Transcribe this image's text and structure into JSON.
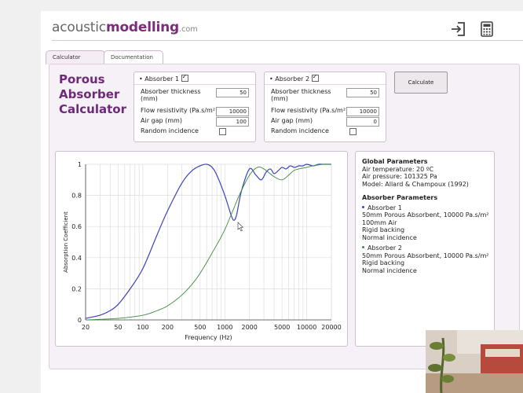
{
  "logo": {
    "part1": "acoustic",
    "part2": "modelling",
    "part3": ".com"
  },
  "tabs": [
    {
      "label": "Calculator"
    },
    {
      "label": "Documentation"
    }
  ],
  "title": {
    "line1": "Porous",
    "line2": "Absorber",
    "line3": "Calculator"
  },
  "absorbers": [
    {
      "header": "Absorber 1",
      "enabled": true,
      "fields": {
        "thickness_label": "Absorber thickness (mm)",
        "thickness_value": "50",
        "resistivity_label": "Flow resistivity (Pa.s/m²)",
        "resistivity_value": "10000",
        "airgap_label": "Air gap (mm)",
        "airgap_value": "100",
        "random_label": "Random incidence"
      }
    },
    {
      "header": "Absorber 2",
      "enabled": true,
      "fields": {
        "thickness_label": "Absorber thickness (mm)",
        "thickness_value": "50",
        "resistivity_label": "Flow resistivity (Pa.s/m²)",
        "resistivity_value": "10000",
        "airgap_label": "Air gap (mm)",
        "airgap_value": "0",
        "random_label": "Random incidence"
      }
    }
  ],
  "calculate_label": "Calculate",
  "info": {
    "global_title": "Global Parameters",
    "global_lines": [
      "Air temperature: 20 ºC",
      "Air pressure: 101325 Pa",
      "Model: Allard & Champoux (1992)"
    ],
    "absorber_title": "Absorber Parameters",
    "a1_name": "Absorber 1",
    "a1_lines": [
      "50mm Porous Absorbent, 10000 Pa.s/m²",
      "100mm Air",
      "Rigid backing",
      "Normal incidence"
    ],
    "a2_name": "Absorber 2",
    "a2_lines": [
      "50mm Porous Absorbent, 10000 Pa.s/m²",
      "Rigid backing",
      "Normal incidence"
    ]
  },
  "colors": {
    "accent": "#6d2a78",
    "series1": "#3a44b8",
    "series2": "#3f8a3f"
  },
  "chart_data": {
    "type": "line",
    "xlabel": "Frequency (Hz)",
    "ylabel": "Absorption Coefficient",
    "xscale": "log",
    "xlim": [
      20,
      20000
    ],
    "ylim": [
      0,
      1
    ],
    "xticks": [
      20,
      50,
      100,
      200,
      500,
      1000,
      2000,
      5000,
      10000,
      20000
    ],
    "xtick_labels": [
      "20",
      "50",
      "100",
      "200",
      "500",
      "1000",
      "2000",
      "5000",
      "10000",
      "20000"
    ],
    "yticks": [
      0,
      0.2,
      0.4,
      0.6,
      0.8,
      1
    ],
    "ytick_labels": [
      "0",
      "0.2",
      "0.4",
      "0.6",
      "0.8",
      "1"
    ],
    "grid": true,
    "series": [
      {
        "name": "Absorber 1",
        "color": "#3a44b8",
        "x": [
          20,
          30,
          40,
          50,
          70,
          100,
          150,
          200,
          300,
          400,
          500,
          600,
          700,
          800,
          1000,
          1200,
          1300,
          1400,
          1600,
          2000,
          2400,
          2800,
          3200,
          3600,
          4000,
          4500,
          5000,
          5600,
          6300,
          7100,
          8000,
          9000,
          10000,
          12000,
          14000,
          16000,
          20000
        ],
        "y": [
          0.01,
          0.03,
          0.06,
          0.1,
          0.2,
          0.33,
          0.55,
          0.7,
          0.88,
          0.96,
          0.99,
          1.0,
          0.98,
          0.93,
          0.8,
          0.67,
          0.64,
          0.68,
          0.83,
          0.97,
          0.93,
          0.9,
          0.95,
          0.97,
          0.94,
          0.96,
          0.98,
          0.97,
          0.99,
          0.98,
          0.99,
          0.99,
          1.0,
          0.99,
          1.0,
          1.0,
          1.0
        ]
      },
      {
        "name": "Absorber 2",
        "color": "#3f8a3f",
        "x": [
          20,
          50,
          100,
          150,
          200,
          300,
          400,
          500,
          700,
          1000,
          1500,
          2000,
          2500,
          3000,
          4000,
          5000,
          6000,
          7000,
          8000,
          10000,
          12000,
          16000,
          20000
        ],
        "y": [
          0.0,
          0.01,
          0.03,
          0.06,
          0.09,
          0.16,
          0.23,
          0.3,
          0.43,
          0.58,
          0.8,
          0.93,
          0.98,
          0.97,
          0.92,
          0.9,
          0.93,
          0.96,
          0.97,
          0.98,
          0.99,
          1.0,
          1.0
        ]
      }
    ]
  }
}
